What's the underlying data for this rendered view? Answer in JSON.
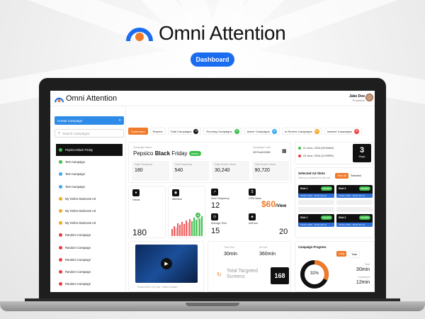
{
  "brand": {
    "name": "Omni Attention",
    "pill": "Dashboard"
  },
  "app": {
    "logo": "Omni Attention",
    "user": {
      "name": "Jake Doe",
      "role": "Proprietor"
    }
  },
  "sidebar": {
    "create_label": "Create Campaign",
    "search_placeholder": "Search Campaigns",
    "campaigns": [
      {
        "label": "Pepsico Black Friday",
        "color": "#3cc04a",
        "selected": true
      },
      {
        "label": "Test Campaign",
        "color": "#3cc04a"
      },
      {
        "label": "Test Campaign",
        "color": "#39a7f0"
      },
      {
        "label": "Test Campaign",
        "color": "#39a7f0"
      },
      {
        "label": "My Online Business Ad",
        "color": "#f5a524"
      },
      {
        "label": "My Online Business Ad",
        "color": "#f5a524"
      },
      {
        "label": "My Online Business Ad",
        "color": "#f5a524"
      },
      {
        "label": "Random Campaign",
        "color": "#ef3b3b"
      },
      {
        "label": "Random Campaign",
        "color": "#ef3b3b"
      },
      {
        "label": "Random Campaign",
        "color": "#ef3b3b"
      },
      {
        "label": "Random Campaign",
        "color": "#ef3b3b"
      },
      {
        "label": "Random Campaign",
        "color": "#ef3b3b"
      },
      {
        "label": "Random Campaign",
        "color": "#ef3b3b"
      }
    ]
  },
  "tabs": [
    {
      "label": "Dashboard",
      "active": true
    },
    {
      "label": "Reports"
    },
    {
      "label": "Total Campaigns",
      "count": "15",
      "color": "#111111"
    },
    {
      "label": "Running Campaigns",
      "count": "17",
      "color": "#3cc04a"
    },
    {
      "label": "Active Campaigns",
      "count": "10",
      "color": "#39a7f0"
    },
    {
      "label": "In Review Campaigns",
      "count": "06",
      "color": "#f5a524"
    },
    {
      "label": "Inactive Campaigns",
      "count": "06",
      "color": "#ef3b3b"
    }
  ],
  "campaign": {
    "name_label": "Campaign Name",
    "name_a": "Pepsico",
    "name_b": "Black",
    "name_c": "Friday",
    "status": "Active",
    "code_label": "Campaign Code",
    "code": "267HuI0198H",
    "stats": [
      {
        "label": "Daily Frequency",
        "value": "180"
      },
      {
        "label": "Total Frequency",
        "value": "540"
      },
      {
        "label": "Daily Screen Views",
        "value": "30,240"
      },
      {
        "label": "Total Screen Views",
        "value": "90,720"
      }
    ]
  },
  "dates": {
    "start": "01 June, 2024 (09:00AM)",
    "end": "03 June, 2024 (12:00PM)",
    "days": "3",
    "days_label": "Days"
  },
  "metrics": {
    "views_label": "Views",
    "views": "180",
    "attention_label": "Attention",
    "attention_badge": "45",
    "view_freq_label": "View Frequency",
    "view_freq": "12",
    "avg_time_label": "Average Time",
    "avg_time": "15",
    "cpm_label": "CPM Value",
    "cpm": "$60",
    "cpm_unit": "/View",
    "ad_hour_label": "Ad/Hour",
    "ad_hour": "20"
  },
  "ad_slots": {
    "title": "Selected Ad Slots",
    "subtitle": "Slots you selected for this ad",
    "btn_left": "View All",
    "btn_right": "Selected",
    "slots": [
      {
        "name": "Slot 1",
        "badge": "Included",
        "time": "TR 09 | 18:00 - 18:30 | 30 min"
      },
      {
        "name": "Slot 2",
        "badge": "Included",
        "time": "TR 09 | 18:00 - 18:30 | 30 min"
      },
      {
        "name": "Slot 1",
        "badge": "Included",
        "time": "TR 09 | 18:00 - 18:30 | 30 min"
      },
      {
        "name": "Slot 2",
        "badge": "Included",
        "time": "TR 09 | 18:00 - 18:30 | 30 min"
      }
    ]
  },
  "video": {
    "caption": "Pepsico.MP4 (2.8 mph + 30sec Doable)"
  },
  "time": {
    "time_slot_label": "Time Slot",
    "time_slot": "30min",
    "ad_slot_label": "Ad Slot",
    "ad_slot": "360min",
    "targeted_label_a": "Total Targeted",
    "targeted_label_b": "Screens",
    "targeted": "168"
  },
  "progress": {
    "title": "Campaign Progress",
    "btn_daily": "Daily",
    "btn_total": "Total",
    "percent": "32%",
    "fraction": 0.32,
    "total_label": "Total",
    "total": "30min",
    "completed_label": "Completed",
    "completed": "12min"
  }
}
